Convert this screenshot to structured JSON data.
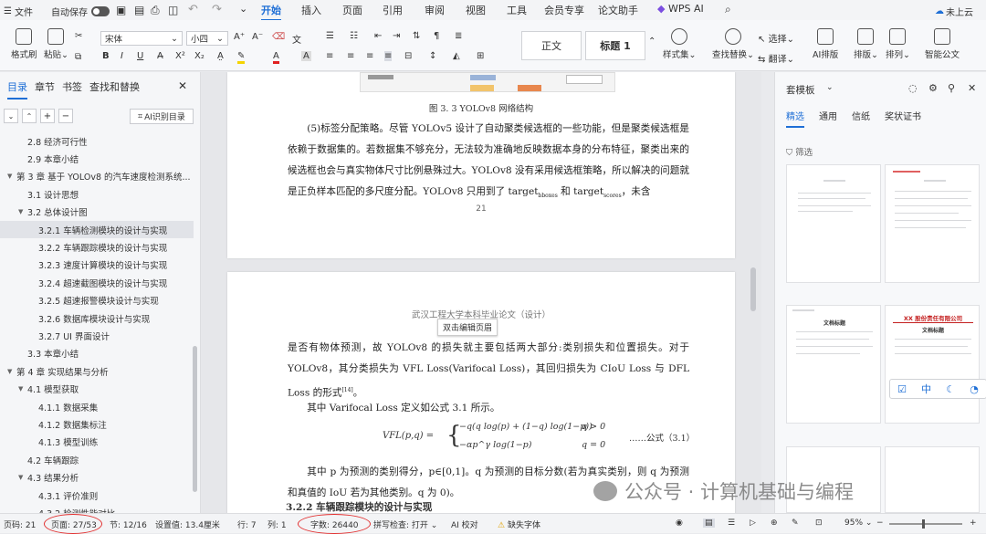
{
  "titlebar": {
    "file": "文件",
    "autosave": "自动保存",
    "menu_tabs": [
      "开始",
      "插入",
      "页面",
      "引用",
      "审阅",
      "视图",
      "工具",
      "会员专享",
      "论文助手",
      "WPS AI"
    ],
    "cloud": "未上云"
  },
  "ribbon": {
    "format_painter": "格式刷",
    "paste": "粘贴",
    "font_name": "宋体",
    "font_size": "小四",
    "style_normal": "正文",
    "style_heading": "标题 1",
    "style_set": "样式集",
    "find_replace": "查找替换",
    "select": "选择",
    "translate": "翻译",
    "ai_layout": "AI排版",
    "layout": "排版",
    "arrange": "排列",
    "smart_doc": "智能公文"
  },
  "nav": {
    "tabs": [
      "目录",
      "章节",
      "书签",
      "查找和替换"
    ],
    "ai_toc": "AI识别目录",
    "items": [
      {
        "text": "2.8 经济可行性",
        "level": 2,
        "arrow": ""
      },
      {
        "text": "2.9 本章小结",
        "level": 2,
        "arrow": ""
      },
      {
        "text": "第 3 章 基于 YOLOv8 的汽车速度检测系统...",
        "level": 1,
        "arrow": "▼"
      },
      {
        "text": "3.1 设计思想",
        "level": 2,
        "arrow": ""
      },
      {
        "text": "3.2 总体设计图",
        "level": 2,
        "arrow": "▼"
      },
      {
        "text": "3.2.1 车辆检测模块的设计与实现",
        "level": 3,
        "arrow": "",
        "selected": true
      },
      {
        "text": "3.2.2 车辆跟踪模块的设计与实现",
        "level": 3,
        "arrow": ""
      },
      {
        "text": "3.2.3 速度计算模块的设计与实现",
        "level": 3,
        "arrow": ""
      },
      {
        "text": "3.2.4 超速截图模块的设计与实现",
        "level": 3,
        "arrow": ""
      },
      {
        "text": "3.2.5 超速报警模块设计与实现",
        "level": 3,
        "arrow": ""
      },
      {
        "text": "3.2.6 数据库模块设计与实现",
        "level": 3,
        "arrow": ""
      },
      {
        "text": "3.2.7 UI 界面设计",
        "level": 3,
        "arrow": ""
      },
      {
        "text": "3.3 本章小结",
        "level": 2,
        "arrow": ""
      },
      {
        "text": "第 4 章 实现结果与分析",
        "level": 1,
        "arrow": "▼"
      },
      {
        "text": "4.1 模型获取",
        "level": 2,
        "arrow": "▼"
      },
      {
        "text": "4.1.1 数据采集",
        "level": 3,
        "arrow": ""
      },
      {
        "text": "4.1.2 数据集标注",
        "level": 3,
        "arrow": ""
      },
      {
        "text": "4.1.3 模型训练",
        "level": 3,
        "arrow": ""
      },
      {
        "text": "4.2 车辆跟踪",
        "level": 2,
        "arrow": ""
      },
      {
        "text": "4.3 结果分析",
        "level": 2,
        "arrow": "▼"
      },
      {
        "text": "4.3.1 评价准则",
        "level": 3,
        "arrow": ""
      },
      {
        "text": "4.3.2 检测性能对比",
        "level": 3,
        "arrow": ""
      }
    ]
  },
  "doc": {
    "fig_caption": "图 3. 3 YOLOv8 网络结构",
    "p1": "(5)标签分配策略。尽管 YOLOv5 设计了自动聚类候选框的一些功能，但是聚类候选框是依赖于数据集的。若数据集不够充分，无法较为准确地反映数据本身的分布特征，聚类出来的候选框也会与真实物体尺寸比例悬殊过大。YOLOv8 没有采用候选框策略，所以解决的问题就是正负样本匹配的多尺度分配。YOLOv8 只用到了 target",
    "p1_sub1": "bboxes",
    "p1_and": " 和 target",
    "p1_sub2": "scores",
    "p1_tail": "，未含",
    "page_no": "21",
    "header": "武汉工程大学本科毕业论文（设计）",
    "header_tip": "双击编辑页眉",
    "p2": "是否有物体预测，故 YOLOv8 的损失就主要包括两大部分:类别损失和位置损失。对于 YOLOv8，其分类损失为 VFL Loss(Varifocal Loss)，其回归损失为 CIoU Loss 与 DFL Loss 的形式",
    "p2_ref": "[14]",
    "p2_end": "。",
    "p3": "其中 Varifocal Loss 定义如公式 3.1 所示。",
    "formula_lhs": "VFL(p,q) =",
    "formula_top": "−q(q log(p) + (1−q) log(1−p))",
    "formula_top_cond": "q > 0",
    "formula_bot": "−αp^γ log(1−p)",
    "formula_bot_cond": "q = 0",
    "formula_label": "……公式（3.1）",
    "p4": "其中 p 为预测的类别得分，p∈[0,1]。q 为预测的目标分数(若为真实类别，则 q 为预测和真值的 IoU 若为其他类别。q 为 0)。",
    "heading": "3.2.2  车辆跟踪模块的设计与实现"
  },
  "right": {
    "title": "套模板",
    "tabs": [
      "精选",
      "通用",
      "信纸",
      "奖状证书"
    ],
    "filter": "筛选",
    "thumb3_title": "文档标题",
    "thumb4_title": "XX 股份责任有限公司",
    "thumb4_sub": "文档标题",
    "float_icons": [
      "中"
    ]
  },
  "status": {
    "page_num": "页码: 21",
    "pages": "页面: 27/53",
    "section": "节: 12/16",
    "setting": "设置值: 13.4厘米",
    "row": "行: 7",
    "col": "列: 1",
    "words": "字数: 26440",
    "spell": "拼写检查: 打开",
    "ai_check": "AI 校对",
    "missing_font": "缺失字体",
    "zoom": "95%"
  },
  "watermark": "公众号 · 计算机基础与编程"
}
